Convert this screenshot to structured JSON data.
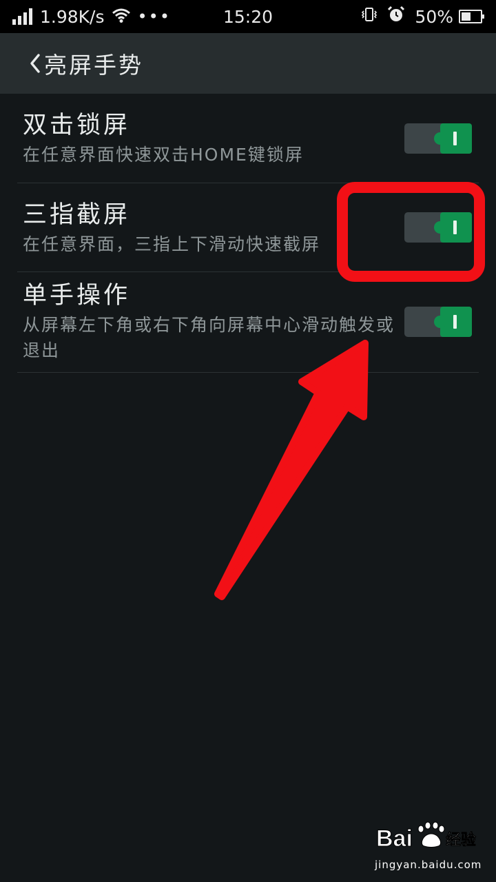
{
  "status_bar": {
    "net_speed": "1.98K/s",
    "more": "•••",
    "time": "15:20",
    "battery_pct": "50%",
    "battery_level": 0.5,
    "icons": [
      "signal-icon",
      "wifi-icon",
      "vibrate-icon",
      "alarm-icon",
      "battery-icon"
    ]
  },
  "header": {
    "title": "亮屏手势",
    "back_icon": "chevron-left-icon"
  },
  "settings": [
    {
      "title": "双击锁屏",
      "desc": "在任意界面快速双击HOME键锁屏",
      "enabled": true
    },
    {
      "title": "三指截屏",
      "desc": "在任意界面，三指上下滑动快速截屏",
      "enabled": true
    },
    {
      "title": "单手操作",
      "desc": "从屏幕左下角或右下角向屏幕中心滑动触发或退出",
      "enabled": true
    }
  ],
  "colors": {
    "background": "#131719",
    "title_bar": "#272d2f",
    "toggle_on": "#10924f",
    "toggle_track": "#3d4548",
    "annotation": "#f21016"
  },
  "watermark": {
    "brand": "Bai",
    "brand_suffix": "经验",
    "url": "jingyan.baidu.com"
  }
}
